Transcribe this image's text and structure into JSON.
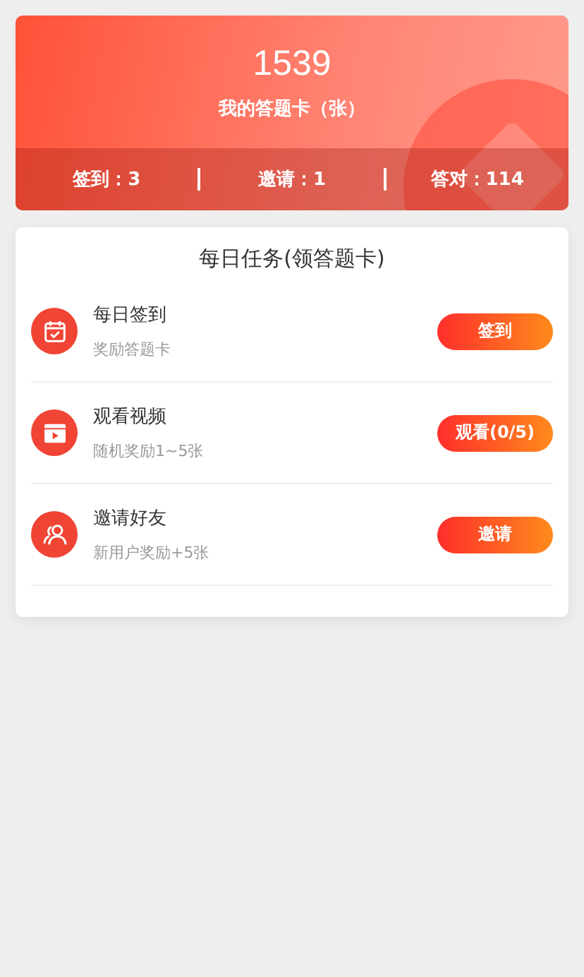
{
  "summary": {
    "count": "1539",
    "label": "我的答题卡（张）",
    "stats": [
      {
        "label": "签到：3"
      },
      {
        "label": "邀请：1"
      },
      {
        "label": "答对：114"
      }
    ]
  },
  "tasks": {
    "title": "每日任务(领答题卡)",
    "items": [
      {
        "kind": "calendar",
        "name": "每日签到",
        "reward": "奖励答题卡",
        "action": "签到"
      },
      {
        "kind": "video",
        "name": "观看视频",
        "reward": "随机奖励1~5张",
        "action": "观看(0/5)"
      },
      {
        "kind": "friends",
        "name": "邀请好友",
        "reward": "新用户奖励+5张",
        "action": "邀请"
      }
    ]
  }
}
